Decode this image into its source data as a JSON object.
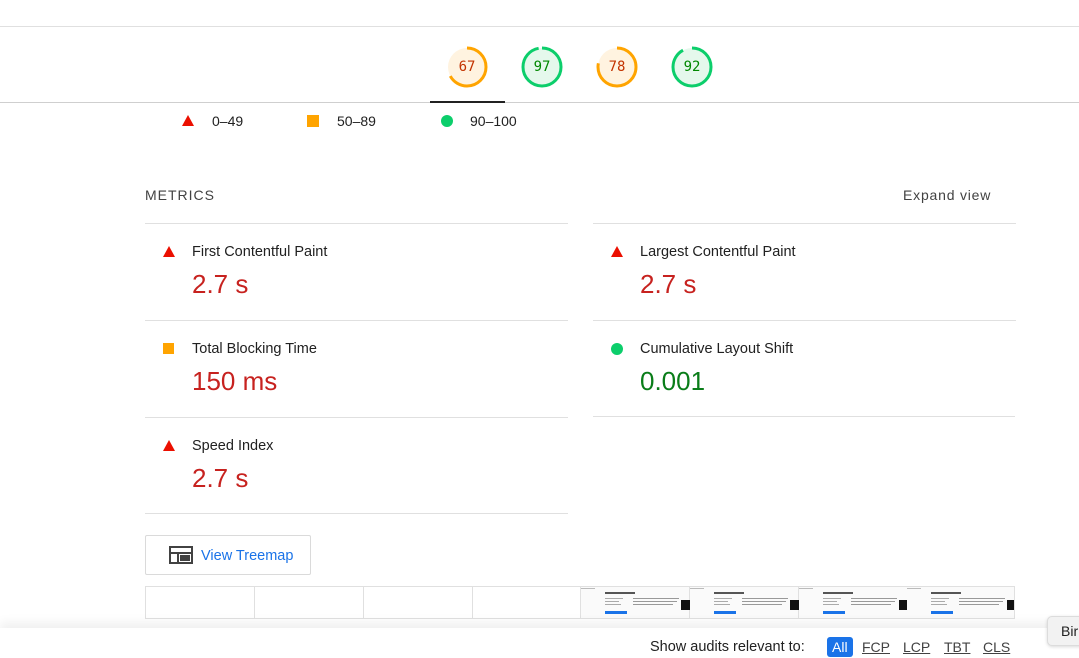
{
  "gauges": [
    {
      "score": "67",
      "value": 0.67,
      "color": "#ffa400",
      "text_color": "#c33300",
      "fill": "#fff3e0"
    },
    {
      "score": "97",
      "value": 0.97,
      "color": "#0cce6b",
      "text_color": "#008800",
      "fill": "#e5f8ec"
    },
    {
      "score": "78",
      "value": 0.78,
      "color": "#ffa400",
      "text_color": "#c33300",
      "fill": "#fff3e0"
    },
    {
      "score": "92",
      "value": 0.92,
      "color": "#0cce6b",
      "text_color": "#008800",
      "fill": "#e5f8ec"
    }
  ],
  "legend": {
    "fail_label": "0–49",
    "average_label": "50–89",
    "pass_label": "90–100"
  },
  "metrics_section": {
    "title": "METRICS",
    "expand_label": "Expand view",
    "items": [
      {
        "label": "First Contentful Paint",
        "value": "2.7 s",
        "status": "fail"
      },
      {
        "label": "Largest Contentful Paint",
        "value": "2.7 s",
        "status": "fail"
      },
      {
        "label": "Total Blocking Time",
        "value": "150 ms",
        "status": "average"
      },
      {
        "label": "Cumulative Layout Shift",
        "value": "0.001",
        "status": "pass"
      },
      {
        "label": "Speed Index",
        "value": "2.7 s",
        "status": "fail"
      }
    ]
  },
  "treemap": {
    "label": "View Treemap",
    "icon": "treemap-icon"
  },
  "audits_filter": {
    "label": "Show audits relevant to:",
    "options": [
      "All",
      "FCP",
      "LCP",
      "TBT",
      "CLS"
    ],
    "selected": "All"
  },
  "tooltip": {
    "text": "Bir"
  },
  "colors": {
    "fail": "#eb0f00",
    "average": "#ffa400",
    "pass": "#0cce6b",
    "link": "#1a73e8"
  }
}
